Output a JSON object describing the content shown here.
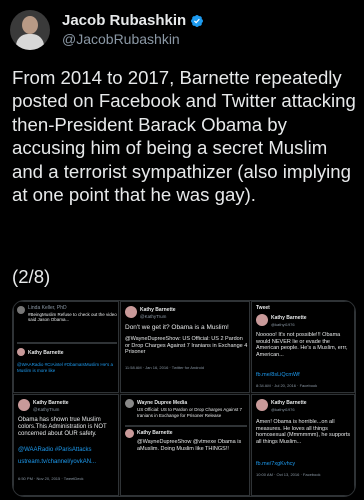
{
  "author": {
    "name": "Jacob Rubashkin",
    "handle": "@JacobRubashkin",
    "verified_badge_color": "#1d9bf0",
    "verified_icon": "verified-badge-icon"
  },
  "tweet": {
    "text": "From 2014 to 2017, Barnette repeatedly posted on Facebook and Twitter attacking then-President Barack Obama by accusing him of being a secret Muslim and a terrorist sympathizer (also implying at one point that he was gay).",
    "counter": "(2/8)"
  },
  "media": {
    "tile1": {
      "line1": "Linda Keller, PhD",
      "line2": "#BeingMuslim Refuse to check out the video said Jason Obama...",
      "author": "Kathy Barnette",
      "tag": "@WAARadio #CIAintel #ObamaIsMuslim He's a Muslim is more like"
    },
    "tile2": {
      "author": "Kathy Barnette",
      "handle": "@KathyTrum",
      "text": "Don't we get it? Obama is a Muslim!",
      "quote": "@WayneDupreeShow: US Official: US 2 Pardon or Drop Charges Against 7 Iranians in Exchange 4 Prisoner",
      "time": "11:58 AM · Jan 16, 2016 · Twitter for Android"
    },
    "tile3": {
      "header": "Tweet",
      "author": "Kathy Barnette",
      "handle": "@kathyt1976",
      "text": "Nooooo! It's not possible!!! Obama would NEVER lie or evade the American people. He's a Muslim, errr, American...",
      "link": "fb.me/8sLiQcmWf",
      "time": "8:34 AM · Jul 20, 2016 · Facebook"
    },
    "tile4": {
      "author": "Kathy Barnette",
      "handle": "@KathyTrum",
      "text": "Obama has shown true Muslim colors.This Administration is NOT concerned about OUR safety.",
      "tags": "@WAARadio #ParisAttacks",
      "link": "ustream.tv/channel/yovkAN...",
      "time": "6:50 PM · Nov 20, 2015 · TweetDeck"
    },
    "tile5": {
      "author": "Wayne Dupree Media",
      "quote": "US Official: US to Pardon or Drop Charges Against 7 Iranians in Exchange for Prisoner Release",
      "author2": "Kathy Barnette",
      "text": "@WayneDupreeShow @vtmexe Obama is aMuslim. Doing Muslim like THINGS!!"
    },
    "tile6": {
      "author": "Kathy Barnette",
      "handle": "@kathyt1976",
      "text": "Amen! Obama is horrible...on all measures. He loves all things homosexual (Mmmmmm), he supports all things Muslim...",
      "link": "fb.me/7xgKvhcy",
      "time": "10:00 AM · Oct 13, 2016 · Facebook"
    }
  }
}
